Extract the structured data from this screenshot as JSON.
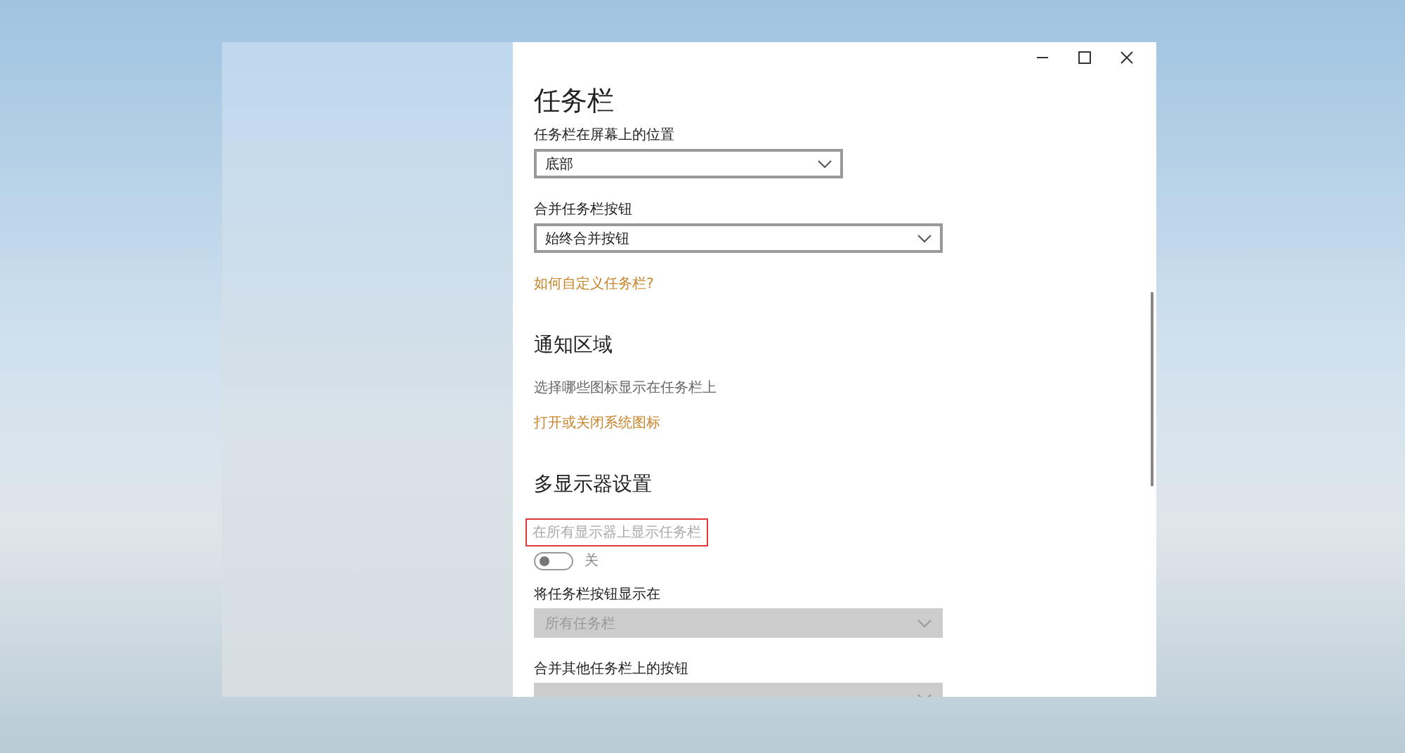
{
  "page_title": "任务栏",
  "settings": [
    {
      "kind": "dropdown",
      "label": "任务栏在屏幕上的位置",
      "value": "底部",
      "disabled": false
    },
    {
      "kind": "dropdown",
      "label": "合并任务栏按钮",
      "value": "始终合并按钮",
      "disabled": false
    },
    {
      "kind": "link",
      "label": "如何自定义任务栏?"
    },
    {
      "kind": "heading",
      "label": "通知区域"
    },
    {
      "kind": "text",
      "label": "选择哪些图标显示在任务栏上"
    },
    {
      "kind": "link",
      "label": "打开或关闭系统图标"
    },
    {
      "kind": "heading",
      "label": "多显示器设置"
    },
    {
      "kind": "toggle",
      "label": "在所有显示器上显示任务栏",
      "disabled": true,
      "highlighted": true,
      "on": false,
      "state_text": "关"
    },
    {
      "kind": "dropdown",
      "label": "将任务栏按钮显示在",
      "value": "所有任务栏",
      "disabled": true
    },
    {
      "kind": "dropdown",
      "label": "合并其他任务栏上的按钮",
      "disabled": true
    }
  ]
}
